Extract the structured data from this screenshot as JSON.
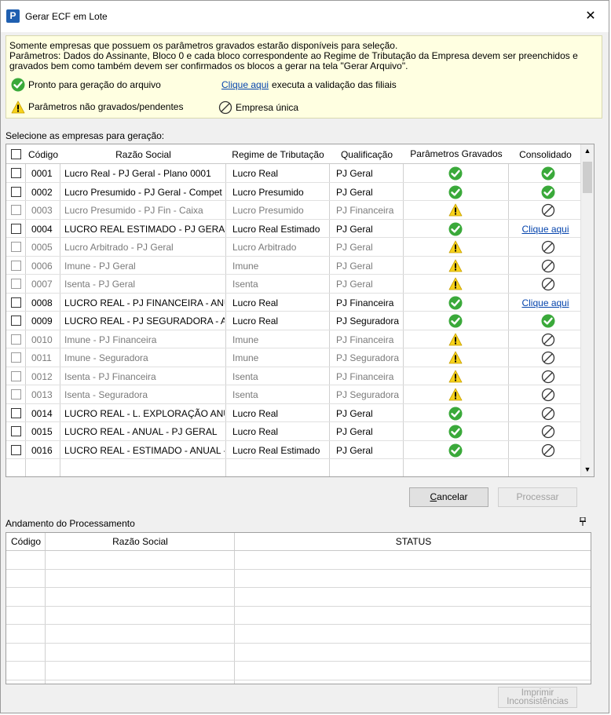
{
  "window": {
    "title": "Gerar ECF em Lote",
    "icon_letter": "P",
    "close_glyph": "✕"
  },
  "info": {
    "line1": "Somente empresas que possuem os parâmetros gravados estarão disponíveis para seleção.",
    "line2": "Parâmetros: Dados do Assinante, Bloco 0 e cada bloco correspondente ao Regime de Tributação da Empresa devem  ser preenchidos e",
    "line3": "gravados bem como também devem ser confirmados os blocos a gerar na tela \"Gerar Arquivo\".",
    "legend_ok": "Pronto para geração do arquivo",
    "legend_link": "Clique aqui",
    "legend_link_suffix": "executa a validação das filiais",
    "legend_warn": "Parâmetros não gravados/pendentes",
    "legend_single": "Empresa única"
  },
  "select_label": "Selecione as empresas para geração:",
  "table": {
    "headers": {
      "codigo": "Código",
      "razao": "Razão Social",
      "regime": "Regime de Tributação",
      "qualificacao": "Qualificação",
      "parametros": "Parâmetros Gravados",
      "consolidado": "Consolidado"
    },
    "rows": [
      {
        "codigo": "0001",
        "razao": "Lucro Real - PJ Geral - Plano 0001",
        "regime": "Lucro Real",
        "qualificacao": "PJ Geral",
        "param": "ok",
        "consol": "ok",
        "enabled": true
      },
      {
        "codigo": "0002",
        "razao": "Lucro Presumido - PJ Geral - Compet",
        "regime": "Lucro Presumido",
        "qualificacao": "PJ Geral",
        "param": "ok",
        "consol": "ok",
        "enabled": true
      },
      {
        "codigo": "0003",
        "razao": "Lucro Presumido - PJ Fin - Caixa",
        "regime": "Lucro Presumido",
        "qualificacao": "PJ Financeira",
        "param": "warn",
        "consol": "single",
        "enabled": false
      },
      {
        "codigo": "0004",
        "razao": "LUCRO REAL ESTIMADO - PJ GERAL",
        "regime": "Lucro Real Estimado",
        "qualificacao": "PJ Geral",
        "param": "ok",
        "consol": "link",
        "enabled": true
      },
      {
        "codigo": "0005",
        "razao": "Lucro Arbitrado - PJ Geral",
        "regime": "Lucro Arbitrado",
        "qualificacao": "PJ Geral",
        "param": "warn",
        "consol": "single",
        "enabled": false
      },
      {
        "codigo": "0006",
        "razao": "Imune - PJ Geral",
        "regime": "Imune",
        "qualificacao": "PJ Geral",
        "param": "warn",
        "consol": "single",
        "enabled": false
      },
      {
        "codigo": "0007",
        "razao": "Isenta - PJ Geral",
        "regime": "Isenta",
        "qualificacao": "PJ Geral",
        "param": "warn",
        "consol": "single",
        "enabled": false
      },
      {
        "codigo": "0008",
        "razao": "LUCRO REAL - PJ FINANCEIRA - ANUAL",
        "regime": "Lucro Real",
        "qualificacao": "PJ Financeira",
        "param": "ok",
        "consol": "link",
        "enabled": true
      },
      {
        "codigo": "0009",
        "razao": "LUCRO REAL - PJ SEGURADORA - ANUAL",
        "regime": "Lucro Real",
        "qualificacao": "PJ Seguradora",
        "param": "ok",
        "consol": "ok",
        "enabled": true
      },
      {
        "codigo": "0010",
        "razao": "Imune - PJ Financeira",
        "regime": "Imune",
        "qualificacao": "PJ Financeira",
        "param": "warn",
        "consol": "single",
        "enabled": false
      },
      {
        "codigo": "0011",
        "razao": "Imune - Seguradora",
        "regime": "Imune",
        "qualificacao": "PJ Seguradora",
        "param": "warn",
        "consol": "single",
        "enabled": false
      },
      {
        "codigo": "0012",
        "razao": "Isenta - PJ Financeira",
        "regime": "Isenta",
        "qualificacao": "PJ Financeira",
        "param": "warn",
        "consol": "single",
        "enabled": false
      },
      {
        "codigo": "0013",
        "razao": "Isenta - Seguradora",
        "regime": "Isenta",
        "qualificacao": "PJ Seguradora",
        "param": "warn",
        "consol": "single",
        "enabled": false
      },
      {
        "codigo": "0014",
        "razao": "LUCRO REAL - L. EXPLORAÇÃO ANUAL",
        "regime": "Lucro Real",
        "qualificacao": "PJ Geral",
        "param": "ok",
        "consol": "single",
        "enabled": true
      },
      {
        "codigo": "0015",
        "razao": "LUCRO REAL - ANUAL - PJ GERAL",
        "regime": "Lucro Real",
        "qualificacao": "PJ Geral",
        "param": "ok",
        "consol": "single",
        "enabled": true
      },
      {
        "codigo": "0016",
        "razao": "LUCRO REAL - ESTIMADO - ANUAL - PJ",
        "regime": "Lucro Real Estimado",
        "qualificacao": "PJ Geral",
        "param": "ok",
        "consol": "single",
        "enabled": true
      }
    ],
    "consol_link_label": "Clique aqui"
  },
  "buttons": {
    "cancelar_prefix": "C",
    "cancelar_rest": "ancelar",
    "processar": "Processar",
    "imprimir_line1": "Imprimir",
    "imprimir_line2": "Inconsistências"
  },
  "progress": {
    "title": "Andamento do Processamento",
    "pin_glyph": "📌",
    "headers": {
      "codigo": "Código",
      "razao": "Razão Social",
      "status": "STATUS"
    }
  },
  "colors": {
    "ok_green": "#3aa93a",
    "warn_yellow": "#f7d21b",
    "link_blue": "#0645ad",
    "info_bg": "#ffffe1"
  }
}
